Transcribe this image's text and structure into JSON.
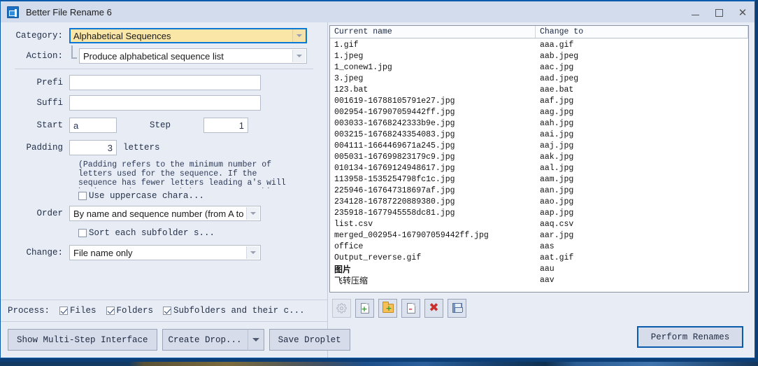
{
  "window": {
    "title": "Better File Rename 6",
    "icon": "app-icon",
    "minimize": "–",
    "maximize": "□",
    "close": "✕"
  },
  "form": {
    "category": {
      "label": "Category:",
      "value": "Alphabetical Sequences"
    },
    "action": {
      "label": "Action:",
      "value": "Produce alphabetical sequence list"
    },
    "prefix": {
      "label": "Prefi",
      "value": "",
      "placeholder": ""
    },
    "suffix": {
      "label": "Suffi",
      "value": "",
      "placeholder": ""
    },
    "start": {
      "label": "Start",
      "value": "a"
    },
    "step": {
      "label": "Step",
      "value": "1"
    },
    "padding": {
      "label": "Padding",
      "value": "3",
      "unit": "letters"
    },
    "padding_help": "(Padding refers to the minimum number of letters used for the sequence. If the sequence has fewer letters leading a's will be inserted, e.g. a, b becomes aaa, aab)",
    "uppercase": {
      "label": "Use uppercase chara...",
      "checked": false
    },
    "order": {
      "label": "Order",
      "value": "By name and sequence number (from A to Z)"
    },
    "sort_subfolder": {
      "label": "Sort each subfolder s...",
      "checked": false
    },
    "change": {
      "label": "Change:",
      "value": "File name only"
    }
  },
  "process": {
    "label": "Process:",
    "options": [
      {
        "label": "Files",
        "checked": true
      },
      {
        "label": "Folders",
        "checked": true
      },
      {
        "label": "Subfolders and their c...",
        "checked": true
      }
    ]
  },
  "buttons": {
    "multi_step": "Show Multi-Step Interface",
    "create_droplet": "Create Drop...",
    "create_droplet_arrow": "▼",
    "save_droplet": "Save Droplet",
    "perform_renames": "Perform Renames"
  },
  "list": {
    "columns": [
      "Current name",
      "Change to"
    ],
    "rows": [
      {
        "current": "1.gif",
        "new": "aaa.gif"
      },
      {
        "current": "1.jpeg",
        "new": "aab.jpeg"
      },
      {
        "current": "1_conew1.jpg",
        "new": "aac.jpg"
      },
      {
        "current": "3.jpeg",
        "new": "aad.jpeg"
      },
      {
        "current": "123.bat",
        "new": "aae.bat"
      },
      {
        "current": "001619-16788105791e27.jpg",
        "new": "aaf.jpg"
      },
      {
        "current": "002954-167907059442ff.jpg",
        "new": "aag.jpg"
      },
      {
        "current": "003033-16768242333b9e.jpg",
        "new": "aah.jpg"
      },
      {
        "current": "003215-16768243354083.jpg",
        "new": "aai.jpg"
      },
      {
        "current": "004111-1664469671a245.jpg",
        "new": "aaj.jpg"
      },
      {
        "current": "005031-167699823179c9.jpg",
        "new": "aak.jpg"
      },
      {
        "current": "010134-16769124948617.jpg",
        "new": "aal.jpg"
      },
      {
        "current": "113958-1535254798fc1c.jpg",
        "new": "aam.jpg"
      },
      {
        "current": "225946-167647318697af.jpg",
        "new": "aan.jpg"
      },
      {
        "current": "234128-16787220889380.jpg",
        "new": "aao.jpg"
      },
      {
        "current": "235918-1677945558dc81.jpg",
        "new": "aap.jpg"
      },
      {
        "current": "list.csv",
        "new": "aaq.csv"
      },
      {
        "current": "merged_002954-167907059442ff.jpg",
        "new": "aar.jpg"
      },
      {
        "current": "office",
        "new": "aas"
      },
      {
        "current": "Output_reverse.gif",
        "new": "aat.gif"
      },
      {
        "current": "图片",
        "new": "aau",
        "cjk": true,
        "bold": true
      },
      {
        "current": "飞转压缩",
        "new": "aav",
        "cjk": true
      }
    ]
  },
  "list_toolbar": [
    {
      "name": "settings-icon",
      "disabled": true
    },
    {
      "name": "add-file-icon",
      "disabled": false
    },
    {
      "name": "add-folder-icon",
      "disabled": false
    },
    {
      "name": "remove-file-icon",
      "disabled": false
    },
    {
      "name": "clear-all-icon",
      "disabled": false
    },
    {
      "name": "save-list-icon",
      "disabled": false
    }
  ],
  "colors": {
    "accent": "#0a5bab",
    "highlight": "#fae7a8",
    "window_bg": "#e8ecf5",
    "desktop": "#0d3f76"
  }
}
